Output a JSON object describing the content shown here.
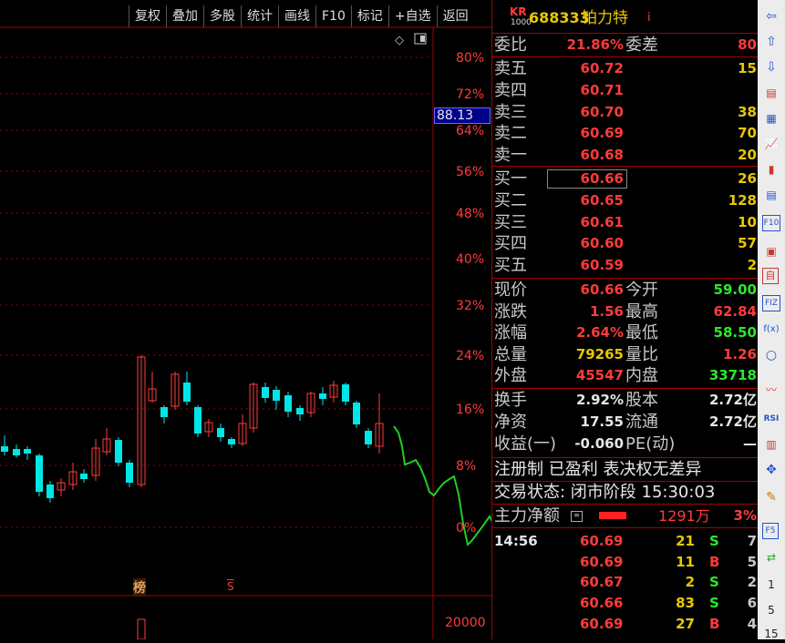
{
  "toolbar": [
    "复权",
    "叠加",
    "多股",
    "统计",
    "画线",
    "F10",
    "标记",
    "+自选",
    "返回"
  ],
  "axis": {
    "pct_ticks": [
      "80%",
      "72%",
      "64%",
      "56%",
      "48%",
      "40%",
      "32%",
      "24%",
      "16%",
      "8%",
      "0%"
    ],
    "price_marker": "88.13",
    "vol_tick": "20000",
    "mark_bang": "榜",
    "mark_s": "S"
  },
  "header": {
    "badge_top": "KR",
    "badge_bottom": "1000",
    "code": "688333",
    "name": "铂力特",
    "flag": "i"
  },
  "weibi": {
    "label": "委比",
    "value": "21.86%",
    "label2": "委差",
    "value2": "80"
  },
  "sell": [
    {
      "label": "卖五",
      "price": "60.72",
      "vol": "15"
    },
    {
      "label": "卖四",
      "price": "60.71",
      "vol": ""
    },
    {
      "label": "卖三",
      "price": "60.70",
      "vol": "38"
    },
    {
      "label": "卖二",
      "price": "60.69",
      "vol": "70"
    },
    {
      "label": "卖一",
      "price": "60.68",
      "vol": "20"
    }
  ],
  "buy": [
    {
      "label": "买一",
      "price": "60.66",
      "vol": "26"
    },
    {
      "label": "买二",
      "price": "60.65",
      "vol": "128"
    },
    {
      "label": "买三",
      "price": "60.61",
      "vol": "10"
    },
    {
      "label": "买四",
      "price": "60.60",
      "vol": "57"
    },
    {
      "label": "买五",
      "price": "60.59",
      "vol": "2"
    }
  ],
  "quote": [
    {
      "l1": "现价",
      "v1": "60.66",
      "c1": "red",
      "l2": "今开",
      "v2": "59.00",
      "c2": "green"
    },
    {
      "l1": "涨跌",
      "v1": "1.56",
      "c1": "red",
      "l2": "最高",
      "v2": "62.84",
      "c2": "red"
    },
    {
      "l1": "涨幅",
      "v1": "2.64%",
      "c1": "red",
      "l2": "最低",
      "v2": "58.50",
      "c2": "green"
    },
    {
      "l1": "总量",
      "v1": "79265",
      "c1": "yellow",
      "l2": "量比",
      "v2": "1.26",
      "c2": "red"
    },
    {
      "l1": "外盘",
      "v1": "45547",
      "c1": "red",
      "l2": "内盘",
      "v2": "33718",
      "c2": "green"
    }
  ],
  "stats": [
    {
      "l1": "换手",
      "v1": "2.92%",
      "l2": "股本",
      "v2": "2.72亿"
    },
    {
      "l1": "净资",
      "v1": "17.55",
      "l2": "流通",
      "v2": "2.72亿"
    },
    {
      "l1": "收益(一)",
      "v1": "-0.060",
      "l2": "PE(动)",
      "v2": "—"
    }
  ],
  "info": {
    "tags": "注册制 已盈利 表决权无差异",
    "status": "交易状态: 闭市阶段 15:30:03"
  },
  "main_force": {
    "label": "主力净额",
    "value": "1291万",
    "pct": "3%"
  },
  "ticks": {
    "time": "14:56",
    "rows": [
      {
        "price": "60.69",
        "vol": "21",
        "side": "S",
        "n": "7"
      },
      {
        "price": "60.69",
        "vol": "11",
        "side": "B",
        "n": "5"
      },
      {
        "price": "60.67",
        "vol": "2",
        "side": "S",
        "n": "2"
      },
      {
        "price": "60.66",
        "vol": "83",
        "side": "S",
        "n": "6"
      },
      {
        "price": "60.69",
        "vol": "27",
        "side": "B",
        "n": "4"
      }
    ]
  },
  "sidebar": {
    "n1": "1",
    "n2": "5",
    "n3": "15"
  },
  "colors": {
    "up": "#ff3b3b",
    "down": "#00e6e6",
    "grid": "#a00000",
    "line": "#22cc22",
    "vol_bar": "#e8c800"
  }
}
